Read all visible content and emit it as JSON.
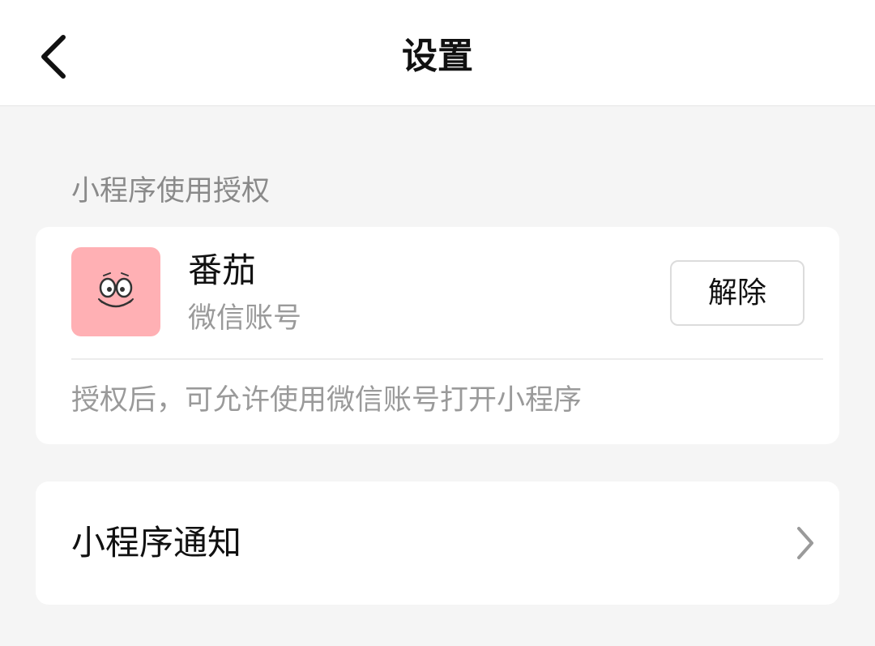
{
  "header": {
    "title": "设置",
    "back_icon": "chevron-left-icon"
  },
  "authorization": {
    "section_label": "小程序使用授权",
    "app": {
      "name": "番茄",
      "account_type": "微信账号",
      "avatar_color": "#ffb0b4",
      "revoke_label": "解除"
    },
    "hint": "授权后，可允许使用微信账号打开小程序"
  },
  "notifications": {
    "label": "小程序通知",
    "chevron_icon": "chevron-right-icon"
  },
  "colors": {
    "background": "#f5f5f5",
    "card": "#ffffff",
    "primary_text": "#111111",
    "secondary_text": "#9a9a9a"
  }
}
